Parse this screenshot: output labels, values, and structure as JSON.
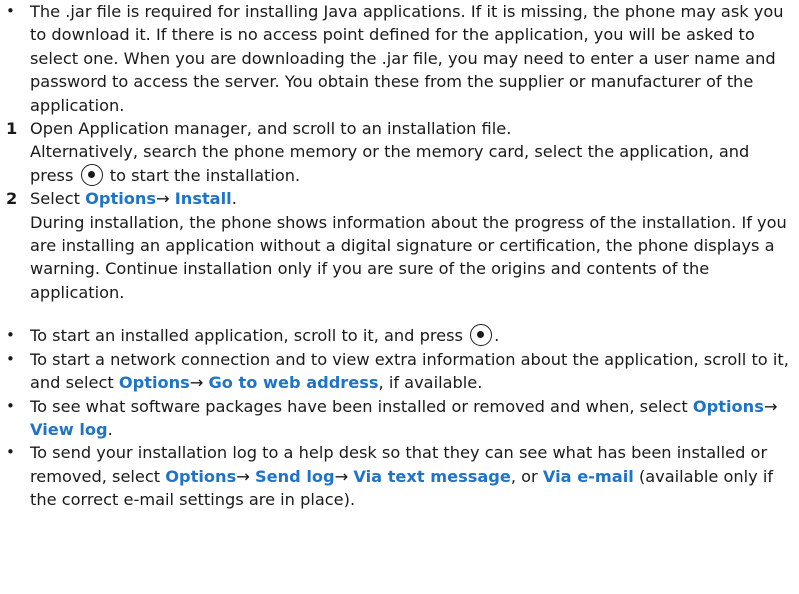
{
  "intro": "The .jar file is required for installing Java applications. If it is missing, the phone may ask you to download it. If there is no access point defined for the application, you will be asked to select one. When you are downloading the .jar file, you may need to enter a user name and password to access the server. You obtain these from the supplier or manufacturer of the application.",
  "steps": [
    {
      "number": "1",
      "line1": "Open Application manager, and scroll to an installation file.",
      "line2_before": "Alternatively, search the phone memory or the memory card, select the application, and press",
      "line2_after": "to start the installation."
    },
    {
      "number": "2",
      "select": "Select",
      "menu1": "Options",
      "arrow": "→",
      "menu2": "Install",
      "period": ".",
      "detail": "During installation, the phone shows information about the progress of the installation. If you are installing an application without a digital signature or certification, the phone displays a warning. Continue installation only if you are sure of the origins and contents of the application."
    }
  ],
  "tips": {
    "start_app": "To start an installed application, scroll to it, and press",
    "start_app_end": ".",
    "web_before": "To start a network connection and to view extra information about the application, scroll to it, and select",
    "web_options": "Options",
    "web_arrow": "→",
    "web_target": "Go to web address",
    "web_after": ", if available.",
    "log_before": "To see what software packages have been installed or removed and when, select",
    "log_options": "Options",
    "log_arrow": "→",
    "log_target": "View log",
    "log_after": ".",
    "send_before": "To send your installation log to a help desk so that they can see what has been installed or removed, select",
    "send_options": "Options",
    "send_arrow1": "→",
    "send_log": "Send log",
    "send_arrow2": "→",
    "send_text": "Via text message",
    "send_or": ", or",
    "send_email": "Via e-mail",
    "send_after": " (available only if the correct e-mail settings are in place)."
  },
  "bullet_char": "•",
  "colors": {
    "accent": "#1f74c9",
    "text": "#1a1a1a"
  },
  "icons": [
    "select-key-icon"
  ]
}
